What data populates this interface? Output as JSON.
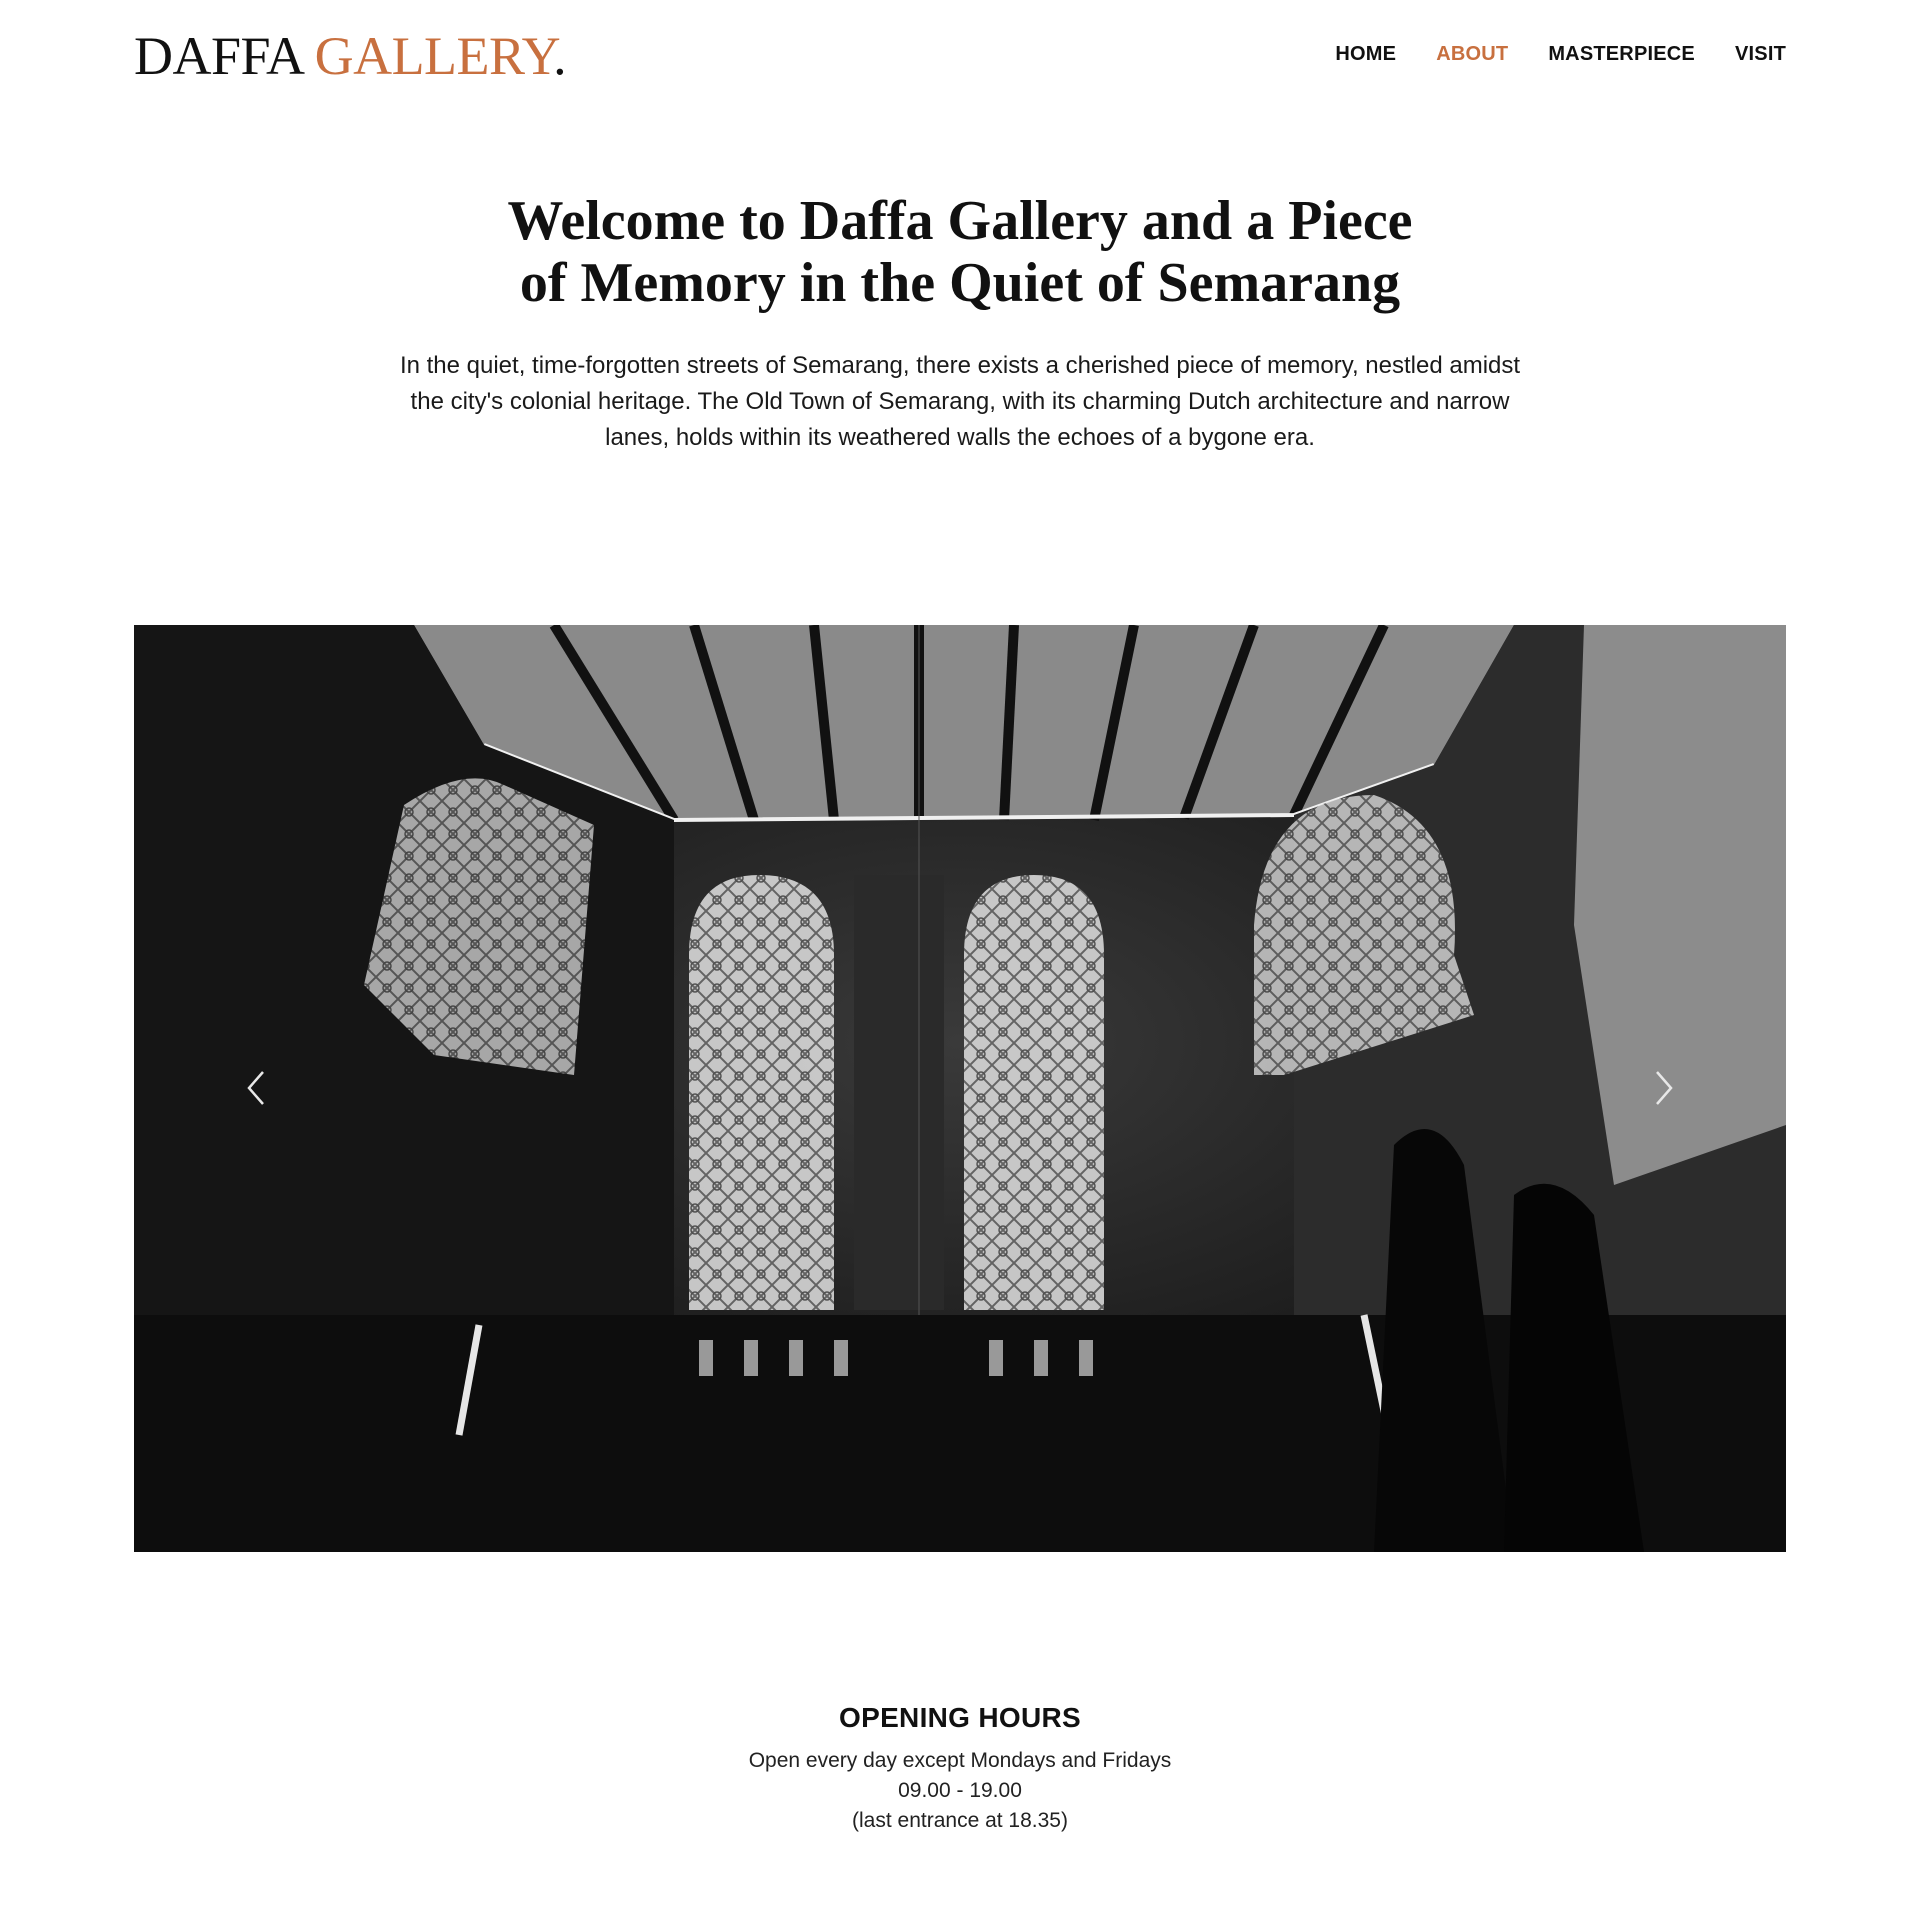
{
  "brand": {
    "name_part1": "DAFFA ",
    "name_part2": "GALLERY",
    "name_dot": ".",
    "accent_color": "#c8703f"
  },
  "nav": {
    "items": [
      {
        "label": "HOME",
        "active": false
      },
      {
        "label": "ABOUT",
        "active": true
      },
      {
        "label": "MASTERPIECE",
        "active": false
      },
      {
        "label": "VISIT",
        "active": false
      }
    ]
  },
  "hero": {
    "title": "Welcome to Daffa Gallery and a Piece of Memory in the Quiet of Semarang",
    "description": "In the quiet, time-forgotten streets of Semarang, there exists a cherished piece of memory, nestled amidst the city's colonial heritage. The Old Town of Semarang, with its charming Dutch architecture and narrow lanes, holds within its weathered walls the echoes of a bygone era."
  },
  "slider": {
    "prev_icon": "chevron-left-icon",
    "next_icon": "chevron-right-icon"
  },
  "opening_hours": {
    "title": "OPENING HOURS",
    "days": "Open every day except Mondays and Fridays",
    "time": "09.00 - 19.00",
    "last_entrance": "(last entrance at 18.35)"
  }
}
